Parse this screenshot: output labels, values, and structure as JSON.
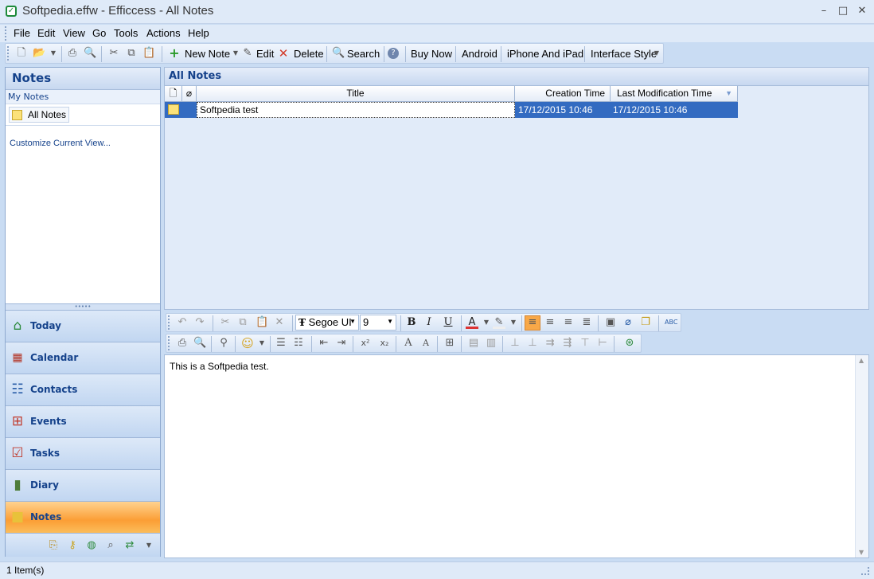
{
  "window": {
    "title": "Softpedia.effw - Efficcess - All Notes",
    "min": "–",
    "max": "□",
    "close": "✕"
  },
  "menu": [
    "File",
    "Edit",
    "View",
    "Go",
    "Tools",
    "Actions",
    "Help"
  ],
  "toolbar": {
    "new_note": "New Note",
    "edit": "Edit",
    "delete": "Delete",
    "search": "Search",
    "buy_now": "Buy Now",
    "android": "Android",
    "iphone": "iPhone And iPad",
    "interface_style": "Interface Style"
  },
  "left": {
    "header": "Notes",
    "section": "My Notes",
    "all_notes": "All Notes",
    "customize": "Customize Current View...",
    "nav": [
      "Today",
      "Calendar",
      "Contacts",
      "Events",
      "Tasks",
      "Diary",
      "Notes"
    ]
  },
  "main": {
    "header": "All Notes",
    "columns": {
      "title": "Title",
      "created": "Creation Time",
      "modified": "Last Modification Time"
    },
    "row": {
      "title": "Softpedia test",
      "created": "17/12/2015 10:46",
      "modified": "17/12/2015 10:46"
    }
  },
  "editor": {
    "font": "Segoe UI",
    "size": "9",
    "bold": "B",
    "italic": "I",
    "underline": "U",
    "content": "This is a Softpedia test."
  },
  "status": {
    "items": "1 Item(s)"
  },
  "colors": {
    "selection": "#336bc1",
    "accent": "#15428b",
    "active_nav": "#fb9e35"
  }
}
